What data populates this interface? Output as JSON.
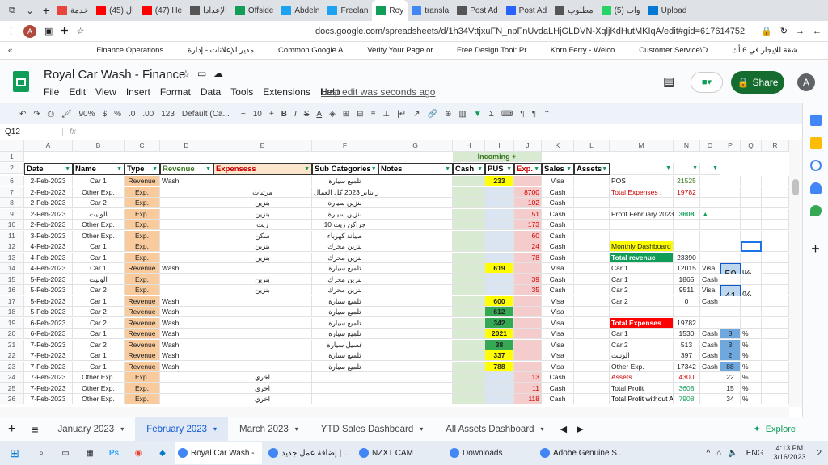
{
  "browser": {
    "tabs": [
      {
        "label": "خدمة ",
        "color": "#e8453c"
      },
      {
        "label": "(45) ال",
        "color": "#ff0000"
      },
      {
        "label": "(47) He",
        "color": "#ff0000"
      },
      {
        "label": "الإعدادا",
        "color": "#555555"
      },
      {
        "label": "Offside",
        "color": "#0f9d58"
      },
      {
        "label": "Abdeln",
        "color": "#1da1f2"
      },
      {
        "label": "Freelan",
        "color": "#1da1f2"
      },
      {
        "label": "Roy",
        "color": "#0f9d58"
      },
      {
        "label": "transla",
        "color": "#4285f4"
      },
      {
        "label": "Post Ad",
        "color": "#555555"
      },
      {
        "label": "Post Ad",
        "color": "#2962ff"
      },
      {
        "label": "مطلوب",
        "color": "#555555"
      },
      {
        "label": "(5) وات",
        "color": "#25d366"
      },
      {
        "label": "Upload",
        "color": "#0078d4"
      }
    ],
    "url": "docs.google.com/spreadsheets/d/1h34VttjxuFN_npFnUvdaLHjGLDVN-XqljKdHutMKIqA/edit#gid=617614752",
    "bookmarks": [
      "Finance Operations...",
      "مدير الإعلانات - إدارة...",
      "Common Google A...",
      "Verify Your Page or...",
      "Free Design Tool: Pr...",
      "Korn Ferry - Welco...",
      "Customer Service\\D...",
      "شقة للإيجار في 6 أك..."
    ]
  },
  "app": {
    "title": "Royal Car Wash - Finance",
    "menus": [
      "File",
      "Edit",
      "View",
      "Insert",
      "Format",
      "Data",
      "Tools",
      "Extensions",
      "Help"
    ],
    "last_edit": "Last edit was seconds ago",
    "share": "Share",
    "avatar": "A"
  },
  "toolbar": {
    "zoom": "90%",
    "currency": "$",
    "percent": "%",
    "dec_less": ".0",
    "dec_more": ".00",
    "format": "123",
    "font": "Default (Ca...",
    "size": "10",
    "bold": "B",
    "italic": "I",
    "strike": "S",
    "underline_a": "A"
  },
  "formula": {
    "cell": "Q12",
    "fx": "fx"
  },
  "columns": [
    "A",
    "B",
    "C",
    "D",
    "E",
    "F",
    "G",
    "H",
    "I",
    "J",
    "K",
    "L",
    "M",
    "N",
    "O",
    "P",
    "Q",
    "R"
  ],
  "header_row1": {
    "incoming": "Incoming +"
  },
  "headers": [
    "Date",
    "Name",
    "Type",
    "Revenue",
    "Expensess",
    "Sub Categories",
    "Notes",
    "Cash",
    "PUS",
    "Exp.",
    "Sales",
    "Assets"
  ],
  "rows": [
    {
      "n": "6",
      "a": "2-Feb-2023",
      "b": "Car 1",
      "c": "Revenue",
      "d": "Wash",
      "e": "",
      "f": "تلميع سيارة",
      "i": "233",
      "j": "",
      "k": "Visa",
      "m": "POS",
      "nn": "21525",
      "o": "",
      "p": "",
      "q": ""
    },
    {
      "n": "7",
      "a": "2-Feb-2023",
      "b": "Other Exp.",
      "c": "Exp.",
      "d": "",
      "e": "مرتبات",
      "f": "شهر يناير 2023 كل العمال",
      "i": "",
      "j": "8700",
      "k": "Cash",
      "m": "Total Expenses :",
      "nn": "19782",
      "o": "",
      "p": "",
      "q": ""
    },
    {
      "n": "8",
      "a": "2-Feb-2023",
      "b": "Car 2",
      "c": "Exp.",
      "d": "",
      "e": "بنزين",
      "f": "بنزين سيارة",
      "i": "",
      "j": "102",
      "k": "Cash",
      "m": "",
      "nn": "",
      "o": "",
      "p": "",
      "q": ""
    },
    {
      "n": "9",
      "a": "2-Feb-2023",
      "b": "الونيت",
      "c": "Exp.",
      "d": "",
      "e": "بنزين",
      "f": "بنزين سيارة",
      "i": "",
      "j": "51",
      "k": "Cash",
      "m": "Profit February 2023 is ...",
      "nn": "3608",
      "o": "▲",
      "p": "",
      "q": ""
    },
    {
      "n": "10",
      "a": "2-Feb-2023",
      "b": "Other Exp.",
      "c": "Exp.",
      "d": "",
      "e": "زيت",
      "f": "10 جراكن زيت",
      "i": "",
      "j": "173",
      "k": "Cash",
      "m": "",
      "nn": "",
      "o": "",
      "p": "",
      "q": ""
    },
    {
      "n": "11",
      "a": "3-Feb-2023",
      "b": "Other Exp.",
      "c": "Exp.",
      "d": "",
      "e": "سكن",
      "f": "صيانة كهرباء",
      "i": "",
      "j": "60",
      "k": "Cash",
      "m": "",
      "nn": "",
      "o": "",
      "p": "",
      "q": ""
    },
    {
      "n": "12",
      "a": "4-Feb-2023",
      "b": "Car 1",
      "c": "Exp.",
      "d": "",
      "e": "بنزين",
      "f": "بنزين محرك",
      "i": "",
      "j": "24",
      "k": "Cash",
      "m": "Monthly Dashboard",
      "nn": "",
      "o": "",
      "p": "",
      "q": ""
    },
    {
      "n": "13",
      "a": "4-Feb-2023",
      "b": "Car 1",
      "c": "Exp.",
      "d": "",
      "e": "بنزين",
      "f": "بنزين محرك",
      "i": "",
      "j": "78",
      "k": "Cash",
      "m": "Total revenue",
      "nn": "23390",
      "o": "",
      "p": "",
      "q": ""
    },
    {
      "n": "14",
      "a": "4-Feb-2023",
      "b": "Car 1",
      "c": "Revenue",
      "d": "Wash",
      "e": "",
      "f": "تلميع سيارة",
      "i": "619",
      "j": "",
      "k": "Visa",
      "m": "Car 1",
      "nn": "12015",
      "o": "Visa",
      "p": "59",
      "q": "%"
    },
    {
      "n": "15",
      "a": "5-Feb-2023",
      "b": "الونيت",
      "c": "Exp.",
      "d": "",
      "e": "بنزين",
      "f": "بنزين محرك",
      "i": "",
      "j": "39",
      "k": "Cash",
      "m": "Car 1",
      "nn": "1865",
      "o": "Cash",
      "p": "",
      "q": ""
    },
    {
      "n": "16",
      "a": "5-Feb-2023",
      "b": "Car 2",
      "c": "Exp.",
      "d": "",
      "e": "بنزين",
      "f": "بنزين محرك",
      "i": "",
      "j": "35",
      "k": "Cash",
      "m": "Car 2",
      "nn": "9511",
      "o": "Visa",
      "p": "41",
      "q": "%"
    },
    {
      "n": "17",
      "a": "5-Feb-2023",
      "b": "Car 1",
      "c": "Revenue",
      "d": "Wash",
      "e": "",
      "f": "تلميع سيارة",
      "i": "600",
      "j": "",
      "k": "Visa",
      "m": "Car 2",
      "nn": "0",
      "o": "Cash",
      "p": "",
      "q": ""
    },
    {
      "n": "18",
      "a": "5-Feb-2023",
      "b": "Car 2",
      "c": "Revenue",
      "d": "Wash",
      "e": "",
      "f": "تلميع سيارة",
      "i": "612",
      "j": "",
      "k": "Visa",
      "m": "",
      "nn": "",
      "o": "",
      "p": "",
      "q": ""
    },
    {
      "n": "19",
      "a": "6-Feb-2023",
      "b": "Car 2",
      "c": "Revenue",
      "d": "Wash",
      "e": "",
      "f": "تلميع سيارة",
      "i": "342",
      "j": "",
      "k": "Visa",
      "m": "Total Expenses",
      "nn": "19782",
      "o": "",
      "p": "",
      "q": ""
    },
    {
      "n": "20",
      "a": "6-Feb-2023",
      "b": "Car 1",
      "c": "Revenue",
      "d": "Wash",
      "e": "",
      "f": "تلميع سيارة",
      "i": "2021",
      "j": "",
      "k": "Visa",
      "m": "Car 1",
      "nn": "1530",
      "o": "Cash",
      "p": "8",
      "q": "%"
    },
    {
      "n": "21",
      "a": "7-Feb-2023",
      "b": "Car 2",
      "c": "Revenue",
      "d": "Wash",
      "e": "",
      "f": "غسيل سيارة",
      "i": "38",
      "j": "",
      "k": "Visa",
      "m": "Car 2",
      "nn": "513",
      "o": "Cash",
      "p": "3",
      "q": "%"
    },
    {
      "n": "22",
      "a": "7-Feb-2023",
      "b": "Car 1",
      "c": "Revenue",
      "d": "Wash",
      "e": "",
      "f": "تلميع سيارة",
      "i": "337",
      "j": "",
      "k": "Visa",
      "m": "الونيت",
      "nn": "397",
      "o": "Cash",
      "p": "2",
      "q": "%"
    },
    {
      "n": "23",
      "a": "7-Feb-2023",
      "b": "Car 1",
      "c": "Revenue",
      "d": "Wash",
      "e": "",
      "f": "تلميع سيارة",
      "i": "788",
      "j": "",
      "k": "Visa",
      "m": "Other Exp.",
      "nn": "17342",
      "o": "Cash",
      "p": "88",
      "q": "%"
    },
    {
      "n": "24",
      "a": "7-Feb-2023",
      "b": "Other Exp.",
      "c": "Exp.",
      "d": "",
      "e": "اخري",
      "f": "",
      "i": "",
      "j": "13",
      "k": "Cash",
      "m": "Assets",
      "nn": "4300",
      "o": "",
      "p": "22",
      "q": "%"
    },
    {
      "n": "25",
      "a": "7-Feb-2023",
      "b": "Other Exp.",
      "c": "Exp.",
      "d": "",
      "e": "اخري",
      "f": "",
      "i": "",
      "j": "11",
      "k": "Cash",
      "m": "Total Profit",
      "nn": "3608",
      "o": "",
      "p": "15",
      "q": "%"
    },
    {
      "n": "26",
      "a": "7-Feb-2023",
      "b": "Other Exp.",
      "c": "Exp.",
      "d": "",
      "e": "اخري",
      "f": "",
      "i": "",
      "j": "118",
      "k": "Cash",
      "m": "Total Profit without Assets",
      "nn": "7908",
      "o": "",
      "p": "34",
      "q": "%"
    }
  ],
  "sheets": [
    "January 2023",
    "February 2023",
    "March 2023",
    "YTD Sales Dashboard",
    "All Assets Dashboard"
  ],
  "explore": "Explore",
  "taskbar": {
    "items": [
      "Royal Car Wash - ...",
      "إضافة عمل جديد | ...",
      "NZXT CAM",
      "Downloads",
      "Adobe Genuine S..."
    ],
    "lang": "ENG",
    "time": "4:13 PM",
    "date": "3/16/2023",
    "notif": "2"
  }
}
